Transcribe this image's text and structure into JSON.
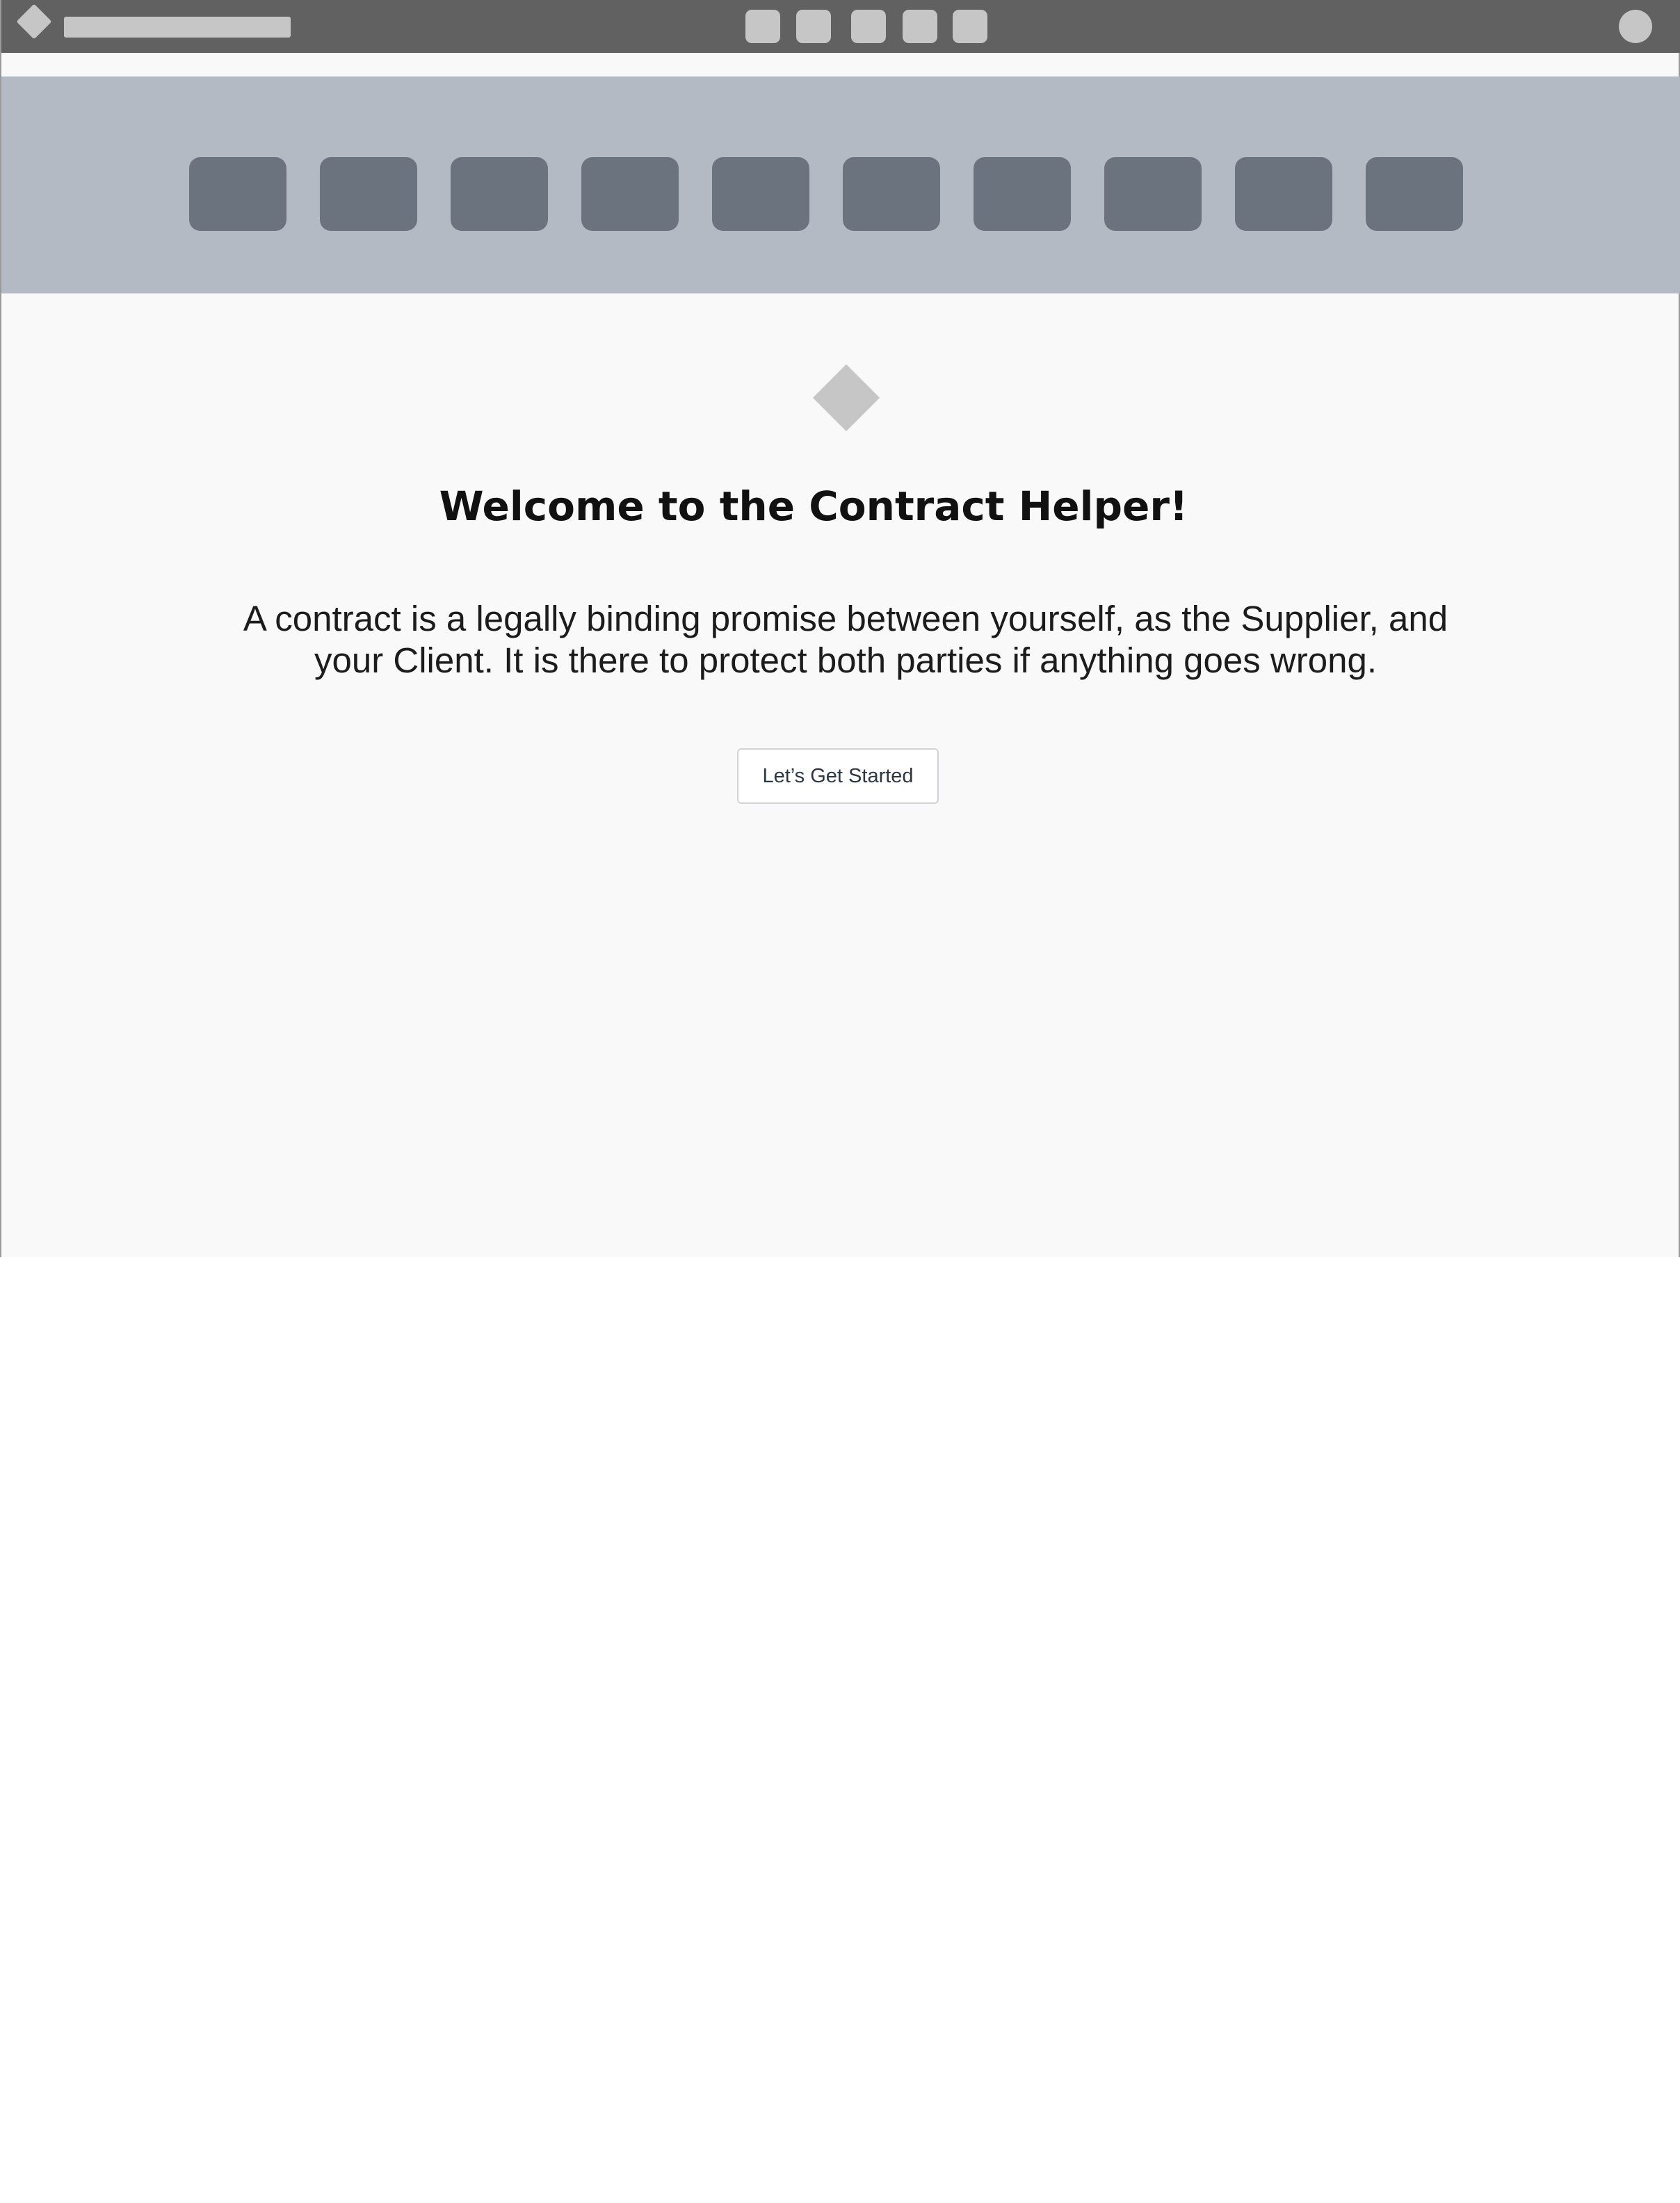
{
  "main": {
    "welcome_title": "Welcome to the Contract Helper!",
    "intro_text": "A contract is a legally binding promise between yourself, as the Supplier, and your Client. It is there to protect both parties if anything goes wrong.",
    "start_button_label": "Let’s Get Started"
  },
  "icons": {
    "app_logo": "diamond-icon",
    "hero": "diamond-icon",
    "avatar": "user-avatar"
  },
  "colors": {
    "topbar": "#616161",
    "nav_band": "#b3bac3",
    "nav_tile": "#6b737e",
    "placeholder": "#c6c6c6",
    "page_background": "#f9f9f9"
  }
}
